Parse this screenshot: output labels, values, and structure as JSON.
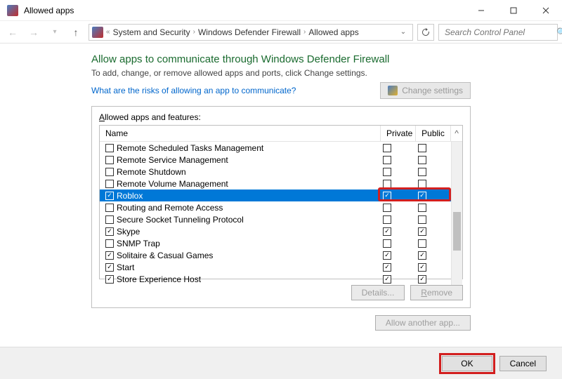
{
  "window": {
    "title": "Allowed apps"
  },
  "breadcrumb": {
    "segments": [
      "System and Security",
      "Windows Defender Firewall",
      "Allowed apps"
    ]
  },
  "search": {
    "placeholder": "Search Control Panel"
  },
  "heading": "Allow apps to communicate through Windows Defender Firewall",
  "subtext": "To add, change, or remove allowed apps and ports, click Change settings.",
  "risks_link": "What are the risks of allowing an app to communicate?",
  "change_settings_label": "Change settings",
  "panel_title": "Allowed apps and features:",
  "columns": {
    "name": "Name",
    "private": "Private",
    "public": "Public"
  },
  "rows": [
    {
      "name": "Remote Scheduled Tasks Management",
      "enabled": false,
      "private": false,
      "public": false,
      "selected": false
    },
    {
      "name": "Remote Service Management",
      "enabled": false,
      "private": false,
      "public": false,
      "selected": false
    },
    {
      "name": "Remote Shutdown",
      "enabled": false,
      "private": false,
      "public": false,
      "selected": false
    },
    {
      "name": "Remote Volume Management",
      "enabled": false,
      "private": false,
      "public": false,
      "selected": false
    },
    {
      "name": "Roblox",
      "enabled": true,
      "private": true,
      "public": true,
      "selected": true
    },
    {
      "name": "Routing and Remote Access",
      "enabled": false,
      "private": false,
      "public": false,
      "selected": false
    },
    {
      "name": "Secure Socket Tunneling Protocol",
      "enabled": false,
      "private": false,
      "public": false,
      "selected": false
    },
    {
      "name": "Skype",
      "enabled": true,
      "private": true,
      "public": true,
      "selected": false
    },
    {
      "name": "SNMP Trap",
      "enabled": false,
      "private": false,
      "public": false,
      "selected": false
    },
    {
      "name": "Solitaire & Casual Games",
      "enabled": true,
      "private": true,
      "public": true,
      "selected": false
    },
    {
      "name": "Start",
      "enabled": true,
      "private": true,
      "public": true,
      "selected": false
    },
    {
      "name": "Store Experience Host",
      "enabled": true,
      "private": true,
      "public": true,
      "selected": false
    }
  ],
  "buttons": {
    "details": "Details...",
    "remove": "Remove",
    "allow_another": "Allow another app...",
    "ok": "OK",
    "cancel": "Cancel"
  }
}
